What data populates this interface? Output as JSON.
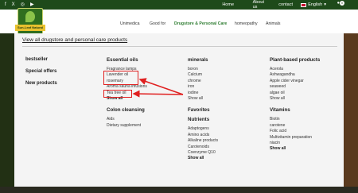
{
  "topbar": {
    "social": [
      "f",
      "X",
      "◎",
      "▶"
    ],
    "home": "Home",
    "about": "About us",
    "contact": "contact",
    "language": "English",
    "cart_count": "0"
  },
  "logo": {
    "ribbon": "Sun-Leaf Natural"
  },
  "nav": {
    "unimedica": "Unimedica",
    "goodfor": "Good for",
    "drugstore": "Drugstore & Personal Care",
    "homeopathy": "homeopathy",
    "animals": "Animals"
  },
  "panel": {
    "view_all": "View all drugstore and personal care products",
    "col1": {
      "bestseller": "bestseller",
      "special": "Special offers",
      "new": "New products"
    },
    "col2": {
      "essential_oils": "Essential oils",
      "items": [
        "Fragrance lamps",
        "Lavender oil",
        "rosemary",
        "Aroma sauna infusions",
        "Tea tree oil"
      ],
      "show_all": "Show all",
      "colon": "Colon cleansing",
      "colon_items": [
        "Aids",
        "Dietary supplement"
      ]
    },
    "col3": {
      "minerals": "minerals",
      "items": [
        "boron",
        "Calcium",
        "chrome",
        "iron",
        "iodine",
        "Show all"
      ],
      "favorites": "Favorites",
      "nutrients": "Nutrients",
      "nutrient_items": [
        "Adaptogens",
        "Amino acids",
        "Alkaline products",
        "Carotenoids",
        "Coenzyme Q10"
      ],
      "show_all": "Show all"
    },
    "col4": {
      "plant": "Plant-based products",
      "items": [
        "Acerola",
        "Ashwagandha",
        "Apple cider vinegar",
        "seaweed",
        "algae oil",
        "Show all"
      ],
      "vitamins": "Vitamins",
      "vitamin_items": [
        "Biotin",
        "carotene",
        "Folic acid",
        "Multivitamin preparation",
        "niacin"
      ],
      "show_all": "Show all"
    }
  },
  "annotation_color": "#e02020"
}
